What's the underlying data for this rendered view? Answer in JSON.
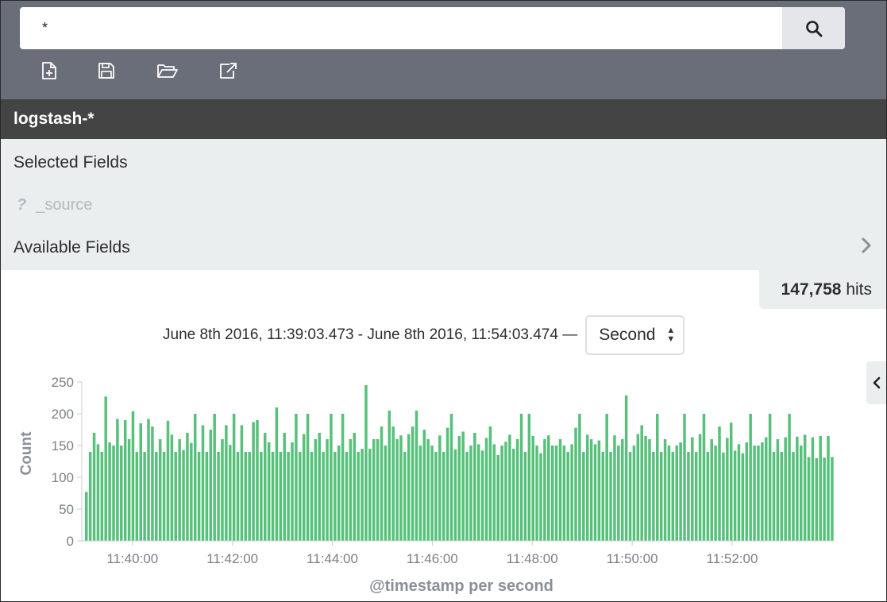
{
  "search": {
    "query": "*"
  },
  "toolbar": {
    "icons": [
      "new-document-icon",
      "save-icon",
      "open-folder-icon",
      "share-icon"
    ]
  },
  "index_pattern": "logstash-*",
  "sidebar": {
    "selected_heading": "Selected Fields",
    "source_field_type": "?",
    "source_field": "_source",
    "available_heading": "Available Fields"
  },
  "hits": {
    "count": "147,758",
    "label": "hits"
  },
  "time_range": "June 8th 2016, 11:39:03.473 - June 8th 2016, 11:54:03.474 —",
  "interval": {
    "selected": "Second"
  },
  "colors": {
    "bar": "#57c17b",
    "topbar": "#6a6e79",
    "index_bar": "#444444"
  },
  "chart_data": {
    "type": "bar",
    "xlabel": "@timestamp per second",
    "ylabel": "Count",
    "ylim": [
      0,
      250
    ],
    "yticks": [
      0,
      50,
      100,
      150,
      200,
      250
    ],
    "xticks": [
      "11:40:00",
      "11:42:00",
      "11:44:00",
      "11:46:00",
      "11:48:00",
      "11:50:00",
      "11:52:00"
    ],
    "x_start": "11:39:03",
    "x_end": "11:54:03",
    "series": [
      {
        "values": [
          77,
          140,
          170,
          152,
          140,
          227,
          155,
          150,
          192,
          150,
          190,
          160,
          204,
          140,
          185,
          140,
          192,
          180,
          140,
          160,
          140,
          189,
          167,
          140,
          160,
          143,
          170,
          154,
          200,
          140,
          182,
          140,
          175,
          200,
          140,
          160,
          182,
          151,
          200,
          140,
          182,
          140,
          140,
          187,
          190,
          140,
          170,
          155,
          140,
          210,
          140,
          170,
          140,
          155,
          200,
          140,
          168,
          200,
          140,
          160,
          170,
          140,
          160,
          200,
          140,
          150,
          200,
          140,
          160,
          170,
          140,
          145,
          245,
          145,
          160,
          160,
          180,
          150,
          205,
          180,
          160,
          166,
          140,
          168,
          180,
          205,
          150,
          175,
          160,
          150,
          140,
          166,
          140,
          178,
          200,
          144,
          165,
          172,
          140,
          150,
          170,
          152,
          142,
          162,
          180,
          152,
          135,
          150,
          156,
          167,
          145,
          160,
          200,
          140,
          200,
          165,
          150,
          138,
          160,
          166,
          150,
          150,
          160,
          150,
          140,
          152,
          178,
          200,
          140,
          167,
          160,
          152,
          158,
          140,
          200,
          140,
          166,
          150,
          160,
          229,
          140,
          150,
          168,
          182,
          165,
          160,
          140,
          200,
          140,
          160,
          150,
          140,
          150,
          155,
          200,
          140,
          163,
          140,
          168,
          200,
          140,
          160,
          150,
          180,
          139,
          162,
          186,
          142,
          152,
          138,
          155,
          200,
          150,
          150,
          155,
          163,
          200,
          140,
          160,
          140,
          163,
          200,
          140,
          164,
          150,
          167,
          132,
          163,
          130,
          165,
          131,
          165,
          132
        ]
      }
    ]
  }
}
